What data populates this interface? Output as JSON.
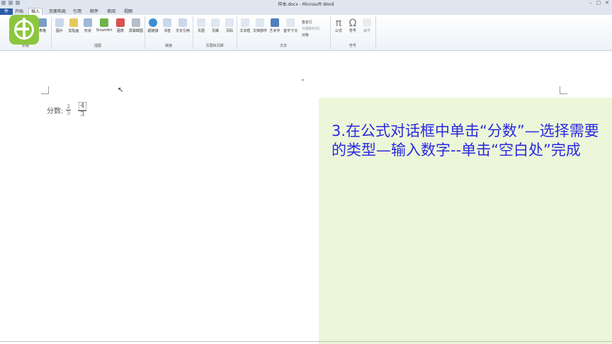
{
  "window": {
    "title": "样本.docx - Microsoft Word",
    "controls": [
      "–",
      "□",
      "✕"
    ]
  },
  "tabs": [
    {
      "label": "件",
      "kind": "file"
    },
    {
      "label": "开始"
    },
    {
      "label": "插入",
      "active": true
    },
    {
      "label": "页面布局"
    },
    {
      "label": "引用"
    },
    {
      "label": "邮件"
    },
    {
      "label": "审阅"
    },
    {
      "label": "视图"
    }
  ],
  "ribbon": {
    "groups": [
      {
        "label": "表格"
      },
      {
        "label": "插图"
      },
      {
        "label": "链接"
      },
      {
        "label": "页眉和页脚"
      },
      {
        "label": "文本"
      },
      {
        "label": "符号"
      }
    ],
    "buttons": {
      "table": "表格",
      "picture": "图片",
      "clipart": "剪贴画",
      "shapes": "形状",
      "smartart": "SmartArt",
      "chart": "图表",
      "screenshot": "屏幕截图",
      "hyperlink": "超链接",
      "bookmark": "书签",
      "crossref": "交叉引用",
      "header": "页眉",
      "footer": "页脚",
      "pagenum": "页码",
      "textbox": "文本框",
      "quickparts": "文档部件",
      "wordart": "艺术字",
      "dropcap": "首字下沉",
      "signature": "签名行",
      "datetime": "日期和时间",
      "object": "对象",
      "equation": "公式",
      "symbol": "符号",
      "number": "编号"
    },
    "icons": {
      "equation": "π",
      "symbol": "Ω"
    }
  },
  "document": {
    "fraction_label": "分数:",
    "fraction1": {
      "numerator": "2",
      "denominator": "5"
    },
    "fraction2": {
      "numerator": "4",
      "denominator": "3"
    }
  },
  "panel": {
    "text": "3.在公式对话框中单击“分数”—选择需要的类型—输入数字--单击“空白处”完成",
    "text_color": "#2a2ae0",
    "background": "#ecf7d9"
  },
  "colors": {
    "logo": "#8cc63f",
    "file_tab": "#2a5caa"
  }
}
